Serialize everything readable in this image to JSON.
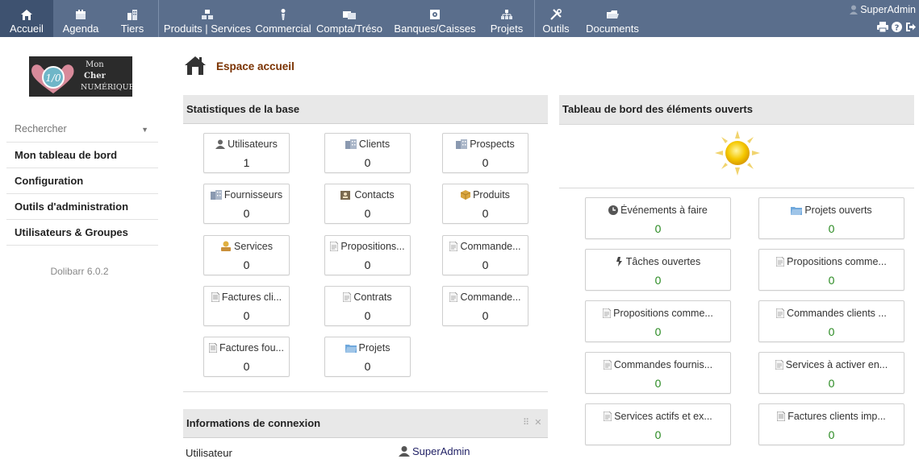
{
  "topbar": {
    "menus": [
      {
        "label": "Accueil",
        "icon": "home-icon"
      },
      {
        "label": "Agenda",
        "icon": "calendar-icon"
      },
      {
        "label": "Tiers",
        "icon": "building-icon"
      },
      {
        "label": "Produits | Services",
        "icon": "boxes-icon"
      },
      {
        "label": "Commercial",
        "icon": "tie-icon"
      },
      {
        "label": "Compta/Tréso",
        "icon": "bills-icon"
      },
      {
        "label": "Banques/Caisses",
        "icon": "safe-icon"
      },
      {
        "label": "Projets",
        "icon": "hierarchy-icon"
      },
      {
        "label": "Outils",
        "icon": "tools-icon"
      },
      {
        "label": "Documents",
        "icon": "folder-icon"
      }
    ],
    "user": "SuperAdmin",
    "colors": {
      "bar": "#5a6e8c",
      "active": "#3e5270"
    }
  },
  "sidebar": {
    "logo_lines": [
      "Mon",
      "Cher",
      "NUMÉRIQUE"
    ],
    "logo_badge": "1/0",
    "search_placeholder": "Rechercher",
    "items": [
      {
        "label": "Mon tableau de bord"
      },
      {
        "label": "Configuration"
      },
      {
        "label": "Outils d'administration"
      },
      {
        "label": "Utilisateurs & Groupes"
      }
    ],
    "version": "Dolibarr 6.0.2"
  },
  "main": {
    "title": "Espace accueil",
    "stats": {
      "header": "Statistiques de la base",
      "boxes": [
        {
          "label": "Utilisateurs",
          "value": "1",
          "icon": "user-icon"
        },
        {
          "label": "Clients",
          "value": "0",
          "icon": "company-icon"
        },
        {
          "label": "Prospects",
          "value": "0",
          "icon": "company-icon"
        },
        {
          "label": "Fournisseurs",
          "value": "0",
          "icon": "company-icon"
        },
        {
          "label": "Contacts",
          "value": "0",
          "icon": "contact-icon"
        },
        {
          "label": "Produits",
          "value": "0",
          "icon": "product-icon"
        },
        {
          "label": "Services",
          "value": "0",
          "icon": "service-icon"
        },
        {
          "label": "Propositions...",
          "value": "0",
          "icon": "document-icon"
        },
        {
          "label": "Commande...",
          "value": "0",
          "icon": "document-icon"
        },
        {
          "label": "Factures cli...",
          "value": "0",
          "icon": "bill-icon"
        },
        {
          "label": "Contrats",
          "value": "0",
          "icon": "document-icon"
        },
        {
          "label": "Commande...",
          "value": "0",
          "icon": "document-icon"
        },
        {
          "label": "Factures fou...",
          "value": "0",
          "icon": "bill-icon"
        },
        {
          "label": "Projets",
          "value": "0",
          "icon": "project-icon"
        }
      ]
    },
    "dashboard": {
      "header": "Tableau de bord des éléments ouverts",
      "weather": "sun-icon",
      "boxes": [
        {
          "label": "Événements à faire",
          "value": "0",
          "icon": "clock-icon"
        },
        {
          "label": "Projets ouverts",
          "value": "0",
          "icon": "project-icon"
        },
        {
          "label": "Tâches ouvertes",
          "value": "0",
          "icon": "task-icon"
        },
        {
          "label": "Propositions comme...",
          "value": "0",
          "icon": "document-icon"
        },
        {
          "label": "Propositions comme...",
          "value": "0",
          "icon": "document-icon"
        },
        {
          "label": "Commandes clients ...",
          "value": "0",
          "icon": "document-icon"
        },
        {
          "label": "Commandes fournis...",
          "value": "0",
          "icon": "document-icon"
        },
        {
          "label": "Services à activer en...",
          "value": "0",
          "icon": "document-icon"
        },
        {
          "label": "Services actifs et ex...",
          "value": "0",
          "icon": "document-icon"
        },
        {
          "label": "Factures clients imp...",
          "value": "0",
          "icon": "bill-icon"
        }
      ],
      "value_color": "#2a8a22"
    },
    "connection": {
      "header": "Informations de connexion",
      "user_label": "Utilisateur",
      "user_value": "SuperAdmin"
    }
  }
}
